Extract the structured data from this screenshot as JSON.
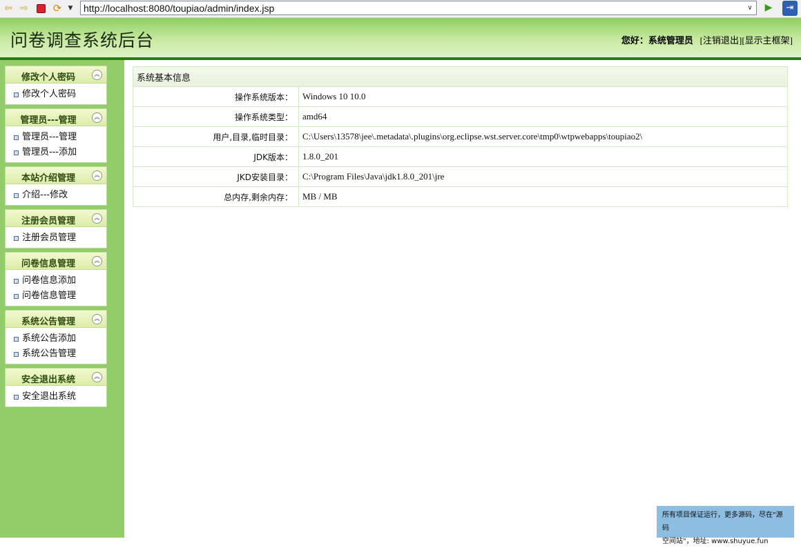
{
  "browser": {
    "url": "http://localhost:8080/toupiao/admin/index.jsp"
  },
  "header": {
    "title": "问卷调查系统后台",
    "greeting": "您好：",
    "username": "系统管理员",
    "logout_link": "[注销退出]",
    "show_frame_link": "[显示主框架]"
  },
  "sidebar": {
    "groups": [
      {
        "title": "修改个人密码",
        "items": [
          "修改个人密码"
        ]
      },
      {
        "title": "管理员---管理",
        "items": [
          "管理员---管理",
          "管理员---添加"
        ]
      },
      {
        "title": "本站介绍管理",
        "items": [
          "介绍---修改"
        ]
      },
      {
        "title": "注册会员管理",
        "items": [
          "注册会员管理"
        ]
      },
      {
        "title": "问卷信息管理",
        "items": [
          "问卷信息添加",
          "问卷信息管理"
        ]
      },
      {
        "title": "系统公告管理",
        "items": [
          "系统公告添加",
          "系统公告管理"
        ]
      },
      {
        "title": "安全退出系统",
        "items": [
          "安全退出系统"
        ]
      }
    ]
  },
  "main": {
    "caption": "系统基本信息",
    "rows": [
      {
        "label": "操作系统版本：",
        "value": "Windows 10  10.0"
      },
      {
        "label": "操作系统类型：",
        "value": "amd64"
      },
      {
        "label": "用户,目录,临时目录：",
        "value": "C:\\Users\\13578\\jee\\.metadata\\.plugins\\org.eclipse.wst.server.core\\tmp0\\wtpwebapps\\toupiao2\\"
      },
      {
        "label": "JDK版本：",
        "value": "1.8.0_201"
      },
      {
        "label": "JKD安装目录：",
        "value": "C:\\Program Files\\Java\\jdk1.8.0_201\\jre"
      },
      {
        "label": "总内存,剩余内存：",
        "value": "MB  /  MB"
      }
    ]
  },
  "watermark": {
    "line1": "所有项目保证运行，更多源码，尽在\"源码",
    "line2": "空间站\"，地址: www.shuyue.fun"
  }
}
